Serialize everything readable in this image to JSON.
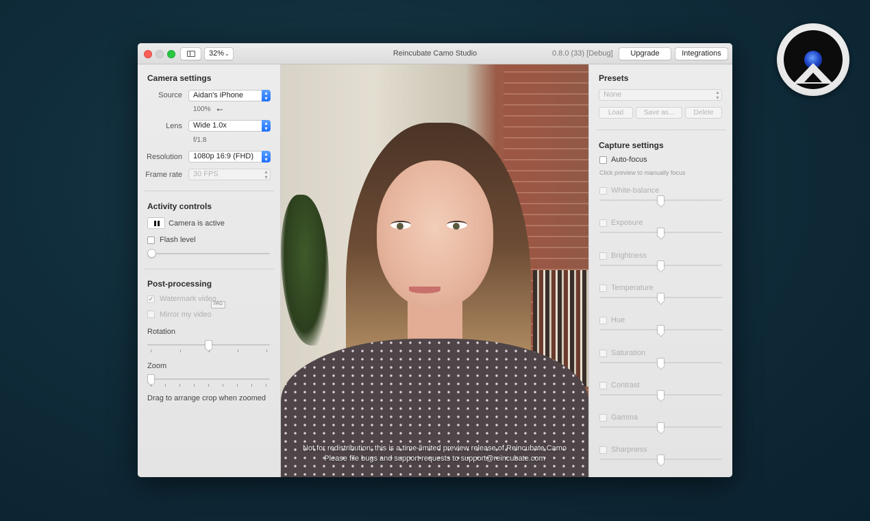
{
  "window": {
    "title": "Reincubate Camo Studio",
    "version": "0.8.0 (33) [Debug]",
    "zoom": "32%",
    "upgrade_label": "Upgrade",
    "integrations_label": "Integrations"
  },
  "camera_settings": {
    "title": "Camera settings",
    "source_label": "Source",
    "source_value": "Aidan's iPhone",
    "battery": "100%",
    "lens_label": "Lens",
    "lens_value": "Wide 1.0x",
    "aperture": "f/1.8",
    "resolution_label": "Resolution",
    "resolution_value": "1080p 16:9 (FHD)",
    "framerate_label": "Frame rate",
    "framerate_value": "30 FPS"
  },
  "activity_controls": {
    "title": "Activity controls",
    "camera_status": "Camera is active",
    "flash_label": "Flash level",
    "flash_level": 0
  },
  "post_processing": {
    "title": "Post-processing",
    "badge": "PRO",
    "watermark_label": "Watermark video",
    "watermark_checked": true,
    "mirror_label": "Mirror my video",
    "rotation_label": "Rotation",
    "rotation_value": 0.5,
    "zoom_label": "Zoom",
    "zoom_value": 0,
    "hint": "Drag to arrange crop when zoomed"
  },
  "video": {
    "watermark_line1": "Not for redistribution; this is a time-limited preview release of Reincubate Camo",
    "watermark_line2": "Please file bugs and support requests to support@reincubate.com"
  },
  "presets": {
    "title": "Presets",
    "selected": "None",
    "load_label": "Load",
    "save_label": "Save as...",
    "delete_label": "Delete"
  },
  "capture_settings": {
    "title": "Capture settings",
    "autofocus_label": "Auto-focus",
    "autofocus_hint": "Click preview to manually focus",
    "sliders": [
      {
        "label": "White-balance",
        "value": 0.5
      },
      {
        "label": "Exposure",
        "value": 0.5
      },
      {
        "label": "Brightness",
        "value": 0.5
      },
      {
        "label": "Temperature",
        "value": 0.5
      },
      {
        "label": "Hue",
        "value": 0.5
      },
      {
        "label": "Saturation",
        "value": 0.5
      },
      {
        "label": "Contrast",
        "value": 0.5
      },
      {
        "label": "Gamma",
        "value": 0.5
      },
      {
        "label": "Sharpness",
        "value": 0.5
      }
    ]
  }
}
